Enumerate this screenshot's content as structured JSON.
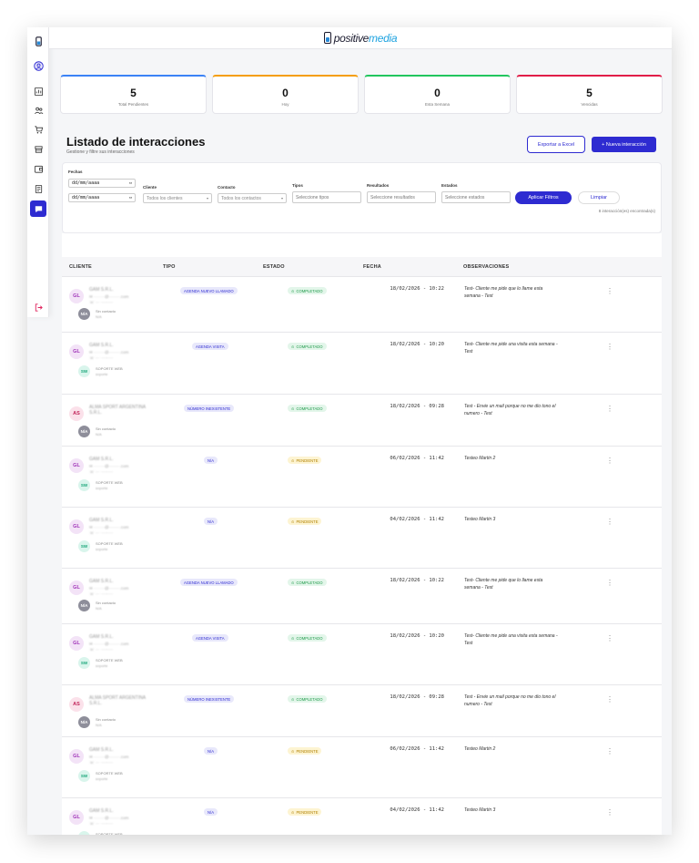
{
  "brand": {
    "part1": "positive",
    "part2": "media"
  },
  "sidebar": {
    "icons": [
      "logo-icon",
      "user-circle-icon",
      "dashboard-icon",
      "users-icon",
      "cart-icon",
      "store-icon",
      "wallet-icon",
      "report-icon",
      "chat-icon",
      "logout-icon"
    ]
  },
  "stats": [
    {
      "value": "5",
      "label": "Total Pendientes",
      "color": "#3b82f6"
    },
    {
      "value": "0",
      "label": "Hoy",
      "color": "#f59e0b"
    },
    {
      "value": "0",
      "label": "Esta Semana",
      "color": "#22c55e"
    },
    {
      "value": "5",
      "label": "Vencidas",
      "color": "#e11d48"
    }
  ],
  "header": {
    "title": "Listado de interacciones",
    "subtitle": "Gestione y filtre sus interacciones",
    "export_label": "Exportar a Excel",
    "new_label": "+ Nueva interacción"
  },
  "filters": {
    "fechas_label": "Fechas",
    "date_from": "dd/mm/aaaa",
    "date_to": "dd/mm/aaaa",
    "cliente_label": "Cliente",
    "cliente_value": "Todos los clientes",
    "contacto_label": "Contacto",
    "contacto_value": "Todos los contactos",
    "tipos_label": "Tipos",
    "tipos_placeholder": "Seleccione tipos",
    "resultados_label": "Resultados",
    "resultados_placeholder": "Seleccione resultados",
    "estados_label": "Estados",
    "estados_placeholder": "Seleccione estados",
    "apply_label": "Aplicar Filtros",
    "clear_label": "Limpiar",
    "count_text": "8 interacción(es) encontrada(s)"
  },
  "table": {
    "headers": [
      "CLIENTE",
      "TIPO",
      "ESTADO",
      "FECHA",
      "OBSERVACIONES"
    ],
    "rows": [
      {
        "initials": "GL",
        "client": "GAM S.R.L.",
        "contact_initials": "N/A",
        "contact": "Sin contacto",
        "contact_sub": "N/A",
        "tipo": "AGENDA NUEVO LLAMADO",
        "estado": "COMPLETADO",
        "fecha": "18/02/2026 - 10:22",
        "obs": "Test- Cliente me pide que lo llame esta semana - Test"
      },
      {
        "initials": "GL",
        "client": "GAM S.R.L.",
        "contact_initials": "SW",
        "contact": "SOPORTE WEB",
        "contact_sub": "soporte",
        "tipo": "AGENDA VISITA",
        "estado": "COMPLETADO",
        "fecha": "18/02/2026 - 10:20",
        "obs": "Test- Cliente me pide una visita esta semana - Test"
      },
      {
        "initials": "AS",
        "client": "ALMA SPORT ARGENTINA S.R.L.",
        "contact_initials": "N/A",
        "contact": "Sin contacto",
        "contact_sub": "N/A",
        "tipo": "NÚMERO INEXISTENTE",
        "estado": "COMPLETADO",
        "fecha": "18/02/2026 - 09:28",
        "obs": "Test - Envie un mail porque no me dio tono el numero - Test"
      },
      {
        "initials": "GL",
        "client": "GAM S.R.L.",
        "contact_initials": "SW",
        "contact": "SOPORTE WEB",
        "contact_sub": "soporte",
        "tipo": "N/A",
        "estado": "PENDIENTE",
        "fecha": "06/02/2026 - 11:42",
        "obs": "Testeo Martin 2"
      },
      {
        "initials": "GL",
        "client": "GAM S.R.L.",
        "contact_initials": "SW",
        "contact": "SOPORTE WEB",
        "contact_sub": "soporte",
        "tipo": "N/A",
        "estado": "PENDIENTE",
        "fecha": "04/02/2026 - 11:42",
        "obs": "Testeo Martin 3"
      },
      {
        "initials": "GL",
        "client": "GAM S.R.L.",
        "contact_initials": "N/A",
        "contact": "Sin contacto",
        "contact_sub": "N/A",
        "tipo": "AGENDA NUEVO LLAMADO",
        "estado": "COMPLETADO",
        "fecha": "18/02/2026 - 10:22",
        "obs": "Test- Cliente me pide que lo llame esta semana - Test"
      },
      {
        "initials": "GL",
        "client": "GAM S.R.L.",
        "contact_initials": "SW",
        "contact": "SOPORTE WEB",
        "contact_sub": "soporte",
        "tipo": "AGENDA VISITA",
        "estado": "COMPLETADO",
        "fecha": "18/02/2026 - 10:20",
        "obs": "Test- Cliente me pide una visita esta semana - Test"
      },
      {
        "initials": "AS",
        "client": "ALMA SPORT ARGENTINA S.R.L.",
        "contact_initials": "N/A",
        "contact": "Sin contacto",
        "contact_sub": "N/A",
        "tipo": "NÚMERO INEXISTENTE",
        "estado": "COMPLETADO",
        "fecha": "18/02/2026 - 09:28",
        "obs": "Test - Envie un mail porque no me dio tono el numero - Test"
      },
      {
        "initials": "GL",
        "client": "GAM S.R.L.",
        "contact_initials": "SW",
        "contact": "SOPORTE WEB",
        "contact_sub": "soporte",
        "tipo": "N/A",
        "estado": "PENDIENTE",
        "fecha": "06/02/2026 - 11:42",
        "obs": "Testeo Martin 2"
      },
      {
        "initials": "GL",
        "client": "GAM S.R.L.",
        "contact_initials": "SW",
        "contact": "SOPORTE WEB",
        "contact_sub": "soporte",
        "tipo": "N/A",
        "estado": "PENDIENTE",
        "fecha": "04/02/2026 - 11:42",
        "obs": "Testeo Martin 3"
      }
    ]
  }
}
